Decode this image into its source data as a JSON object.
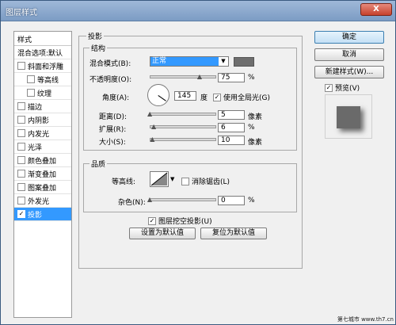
{
  "window": {
    "title": "图层样式",
    "close": "X"
  },
  "left": {
    "header": "样式",
    "items": [
      {
        "label": "混合选项:默认",
        "checkbox": false,
        "checked": false,
        "sub": false,
        "active": false
      },
      {
        "label": "斜面和浮雕",
        "checkbox": true,
        "checked": false,
        "sub": false,
        "active": false
      },
      {
        "label": "等高线",
        "checkbox": true,
        "checked": false,
        "sub": true,
        "active": false
      },
      {
        "label": "纹理",
        "checkbox": true,
        "checked": false,
        "sub": true,
        "active": false
      },
      {
        "label": "描边",
        "checkbox": true,
        "checked": false,
        "sub": false,
        "active": false
      },
      {
        "label": "内阴影",
        "checkbox": true,
        "checked": false,
        "sub": false,
        "active": false
      },
      {
        "label": "内发光",
        "checkbox": true,
        "checked": false,
        "sub": false,
        "active": false
      },
      {
        "label": "光泽",
        "checkbox": true,
        "checked": false,
        "sub": false,
        "active": false
      },
      {
        "label": "颜色叠加",
        "checkbox": true,
        "checked": false,
        "sub": false,
        "active": false
      },
      {
        "label": "渐变叠加",
        "checkbox": true,
        "checked": false,
        "sub": false,
        "active": false
      },
      {
        "label": "图案叠加",
        "checkbox": true,
        "checked": false,
        "sub": false,
        "active": false
      },
      {
        "label": "外发光",
        "checkbox": true,
        "checked": false,
        "sub": false,
        "active": false
      },
      {
        "label": "投影",
        "checkbox": true,
        "checked": true,
        "sub": false,
        "active": true
      }
    ]
  },
  "drop_shadow": {
    "title": "投影",
    "structure_title": "结构",
    "blend_mode_label": "混合模式(B):",
    "blend_mode_value": "正常",
    "blend_color": "#6e6e6e",
    "opacity_label": "不透明度(O):",
    "opacity_value": "75",
    "opacity_unit": "%",
    "angle_label": "角度(A):",
    "angle_value": "145",
    "angle_unit": "度",
    "global_light_label": "使用全局光(G)",
    "global_light_checked": true,
    "distance_label": "距离(D):",
    "distance_value": "5",
    "distance_unit": "像素",
    "spread_label": "扩展(R):",
    "spread_value": "6",
    "spread_unit": "%",
    "size_label": "大小(S):",
    "size_value": "10",
    "size_unit": "像素",
    "quality_title": "品质",
    "contour_label": "等高线:",
    "antialias_label": "消除锯齿(L)",
    "antialias_checked": false,
    "noise_label": "杂色(N):",
    "noise_value": "0",
    "noise_unit": "%",
    "knockout_label": "图层挖空投影(U)",
    "knockout_checked": true,
    "make_default": "设置为默认值",
    "reset_default": "复位为默认值"
  },
  "buttons": {
    "ok": "确定",
    "cancel": "取消",
    "new_style": "新建样式(W)...",
    "preview_label": "预览(V)",
    "preview_checked": true
  },
  "watermark": "第七城市 www.th7.cn"
}
